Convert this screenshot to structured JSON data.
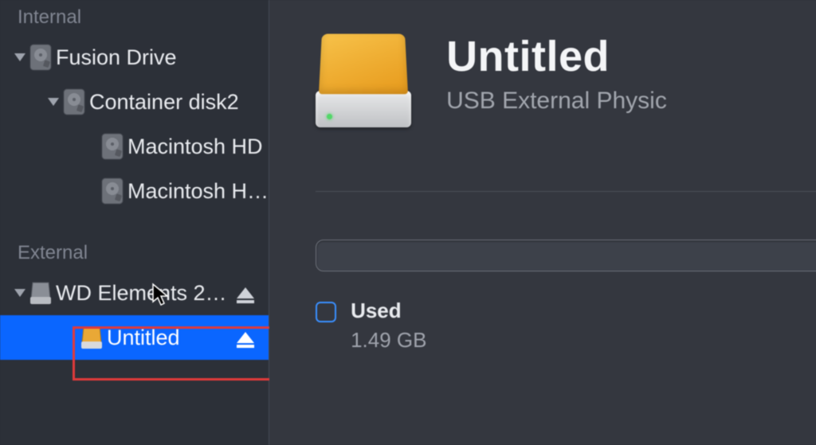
{
  "sidebar": {
    "sections": {
      "internal": {
        "heading": "Internal",
        "fusion": "Fusion Drive",
        "container": "Container disk2",
        "vol1": "Macintosh HD",
        "vol2": "Macintosh H…"
      },
      "external": {
        "heading": "External",
        "wd": "WD Elements 2…",
        "untitled": "Untitled"
      }
    }
  },
  "detail": {
    "title": "Untitled",
    "subtitle": "USB External Physic",
    "legend": {
      "used_label": "Used",
      "used_value": "1.49 GB"
    }
  }
}
